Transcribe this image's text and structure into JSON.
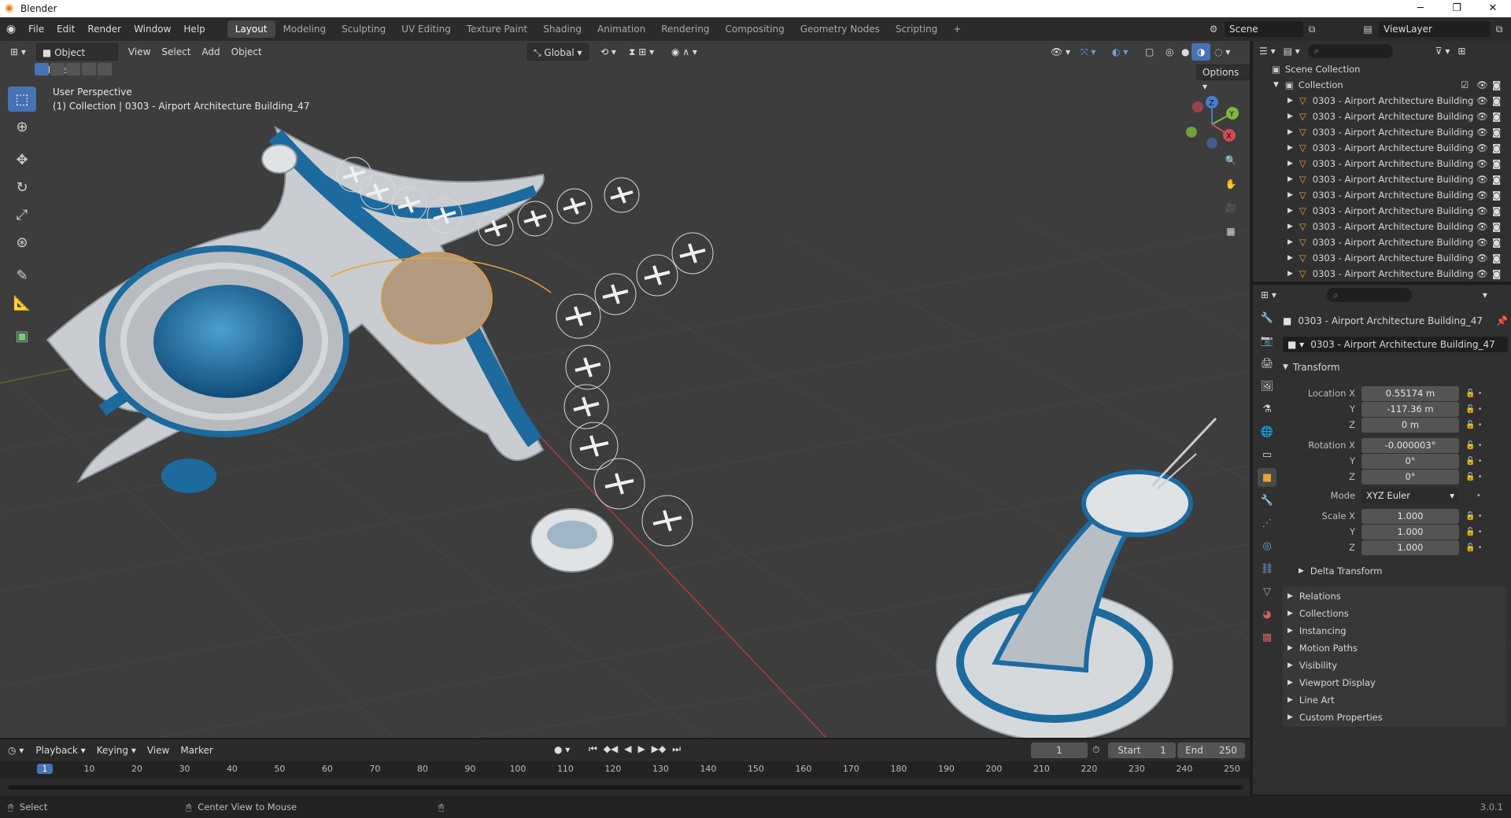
{
  "window": {
    "title": "Blender",
    "app_icon": "blender-logo-icon"
  },
  "menu": {
    "items": [
      "File",
      "Edit",
      "Render",
      "Window",
      "Help"
    ],
    "workspaces": [
      "Layout",
      "Modeling",
      "Sculpting",
      "UV Editing",
      "Texture Paint",
      "Shading",
      "Animation",
      "Rendering",
      "Compositing",
      "Geometry Nodes",
      "Scripting"
    ],
    "active_workspace": "Layout",
    "add_tab": "+",
    "scene": "Scene",
    "view_layer": "ViewLayer"
  },
  "viewport": {
    "mode": "Object Mode",
    "menus": [
      "View",
      "Select",
      "Add",
      "Object"
    ],
    "orientation": "Global",
    "options": "Options",
    "perspective": "User Perspective",
    "collection_info": "(1) Collection | 0303 - Airport Architecture Building_47",
    "gizmo_axes": [
      "Z",
      "Y",
      "X"
    ]
  },
  "outliner": {
    "scene_collection": "Scene Collection",
    "collection": "Collection",
    "items": [
      "0303 - Airport Architecture Building",
      "0303 - Airport Architecture Building",
      "0303 - Airport Architecture Building",
      "0303 - Airport Architecture Building",
      "0303 - Airport Architecture Building",
      "0303 - Airport Architecture Building",
      "0303 - Airport Architecture Building",
      "0303 - Airport Architecture Building",
      "0303 - Airport Architecture Building",
      "0303 - Airport Architecture Building",
      "0303 - Airport Architecture Building",
      "0303 - Airport Architecture Building"
    ]
  },
  "properties": {
    "object_name": "0303 - Airport Architecture Building_47",
    "object_field": "0303 - Airport Architecture Building_47",
    "transform": "Transform",
    "location_label": "Location X",
    "location": [
      "0.55174 m",
      "-117.36 m",
      "0 m"
    ],
    "rotation_label": "Rotation X",
    "rotation": [
      "-0.000003°",
      "0°",
      "0°"
    ],
    "y_label": "Y",
    "z_label": "Z",
    "mode_label": "Mode",
    "mode_value": "XYZ Euler",
    "scale_label": "Scale X",
    "scale": [
      "1.000",
      "1.000",
      "1.000"
    ],
    "delta_transform": "Delta Transform",
    "sections": [
      "Relations",
      "Collections",
      "Instancing",
      "Motion Paths",
      "Visibility",
      "Viewport Display",
      "Line Art",
      "Custom Properties"
    ]
  },
  "timeline": {
    "menus": [
      "Playback",
      "Keying",
      "View",
      "Marker"
    ],
    "current_frame": "1",
    "start_label": "Start",
    "start": "1",
    "end_label": "End",
    "end": "250",
    "ticks": [
      "1",
      "10",
      "20",
      "30",
      "40",
      "50",
      "60",
      "70",
      "80",
      "90",
      "100",
      "110",
      "120",
      "130",
      "140",
      "150",
      "160",
      "170",
      "180",
      "190",
      "200",
      "210",
      "220",
      "230",
      "240",
      "250"
    ]
  },
  "status": {
    "select": "Select",
    "center": "Center View to Mouse",
    "version": "3.0.1"
  },
  "colors": {
    "accent": "#4772b3",
    "orange": "#e8a43a",
    "building_blue": "#1d6a9e"
  }
}
